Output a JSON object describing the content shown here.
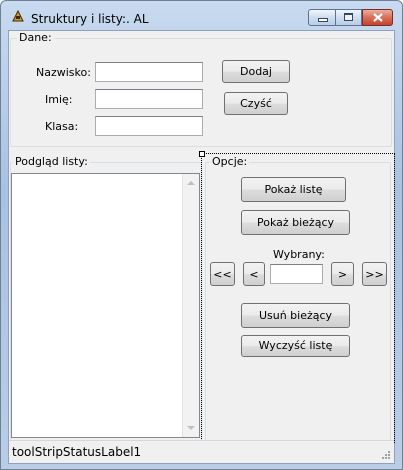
{
  "window": {
    "title": "Struktury i listy:. AL",
    "minimize_glyph": "–",
    "maximize_glyph": "□",
    "close_glyph": "✕"
  },
  "dane_group": {
    "title": "Dane:",
    "nazwisko_label": "Nazwisko:",
    "imie_label": "Imię:",
    "klasa_label": "Klasa:",
    "nazwisko_value": "",
    "imie_value": "",
    "klasa_value": "",
    "add_button": "Dodaj",
    "clear_button": "Czyść"
  },
  "preview_group": {
    "title": "Podgląd listy:",
    "items": []
  },
  "options_group": {
    "title": "Opcje:",
    "show_list_button": "Pokaż listę",
    "show_current_button": "Pokaż bieżący",
    "selected_label": "Wybrany:",
    "selected_value": "",
    "first_button": "<<",
    "prev_button": "<",
    "next_button": ">",
    "last_button": ">>",
    "delete_current_button": "Usuń bieżący",
    "clear_list_button": "Wyczyść listę"
  },
  "status": {
    "label": "toolStripStatusLabel1"
  }
}
